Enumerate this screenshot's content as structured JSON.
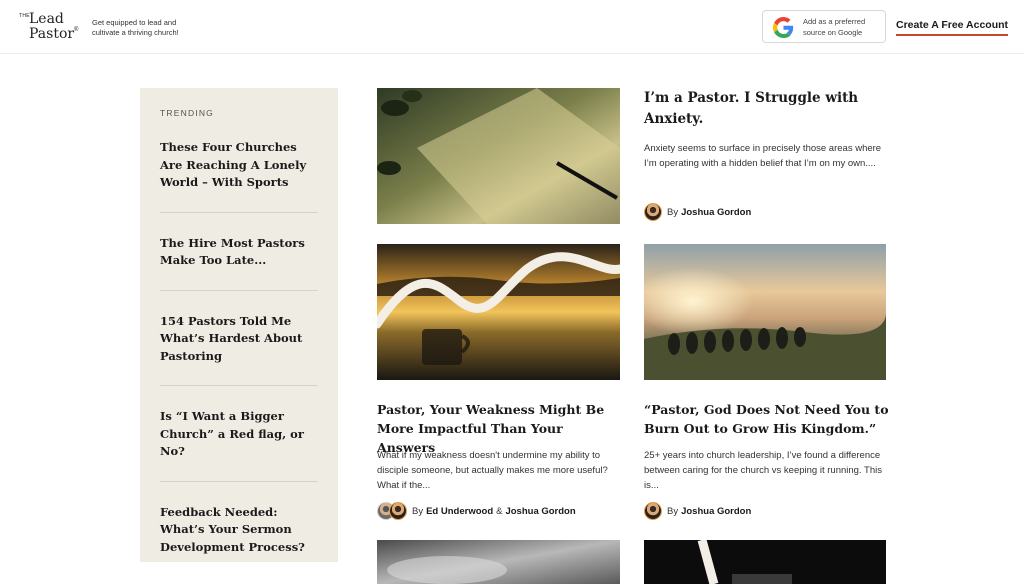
{
  "header": {
    "logo": {
      "the": "THE",
      "line1": "Lead",
      "line2": "Pastor",
      "reg": "®"
    },
    "tagline": "Get equipped to lead and cultivate a thriving church!",
    "google_badge": {
      "text": "Add as a preferred source on Google",
      "icon": "google-g-icon"
    },
    "cta": "Create A Free Account"
  },
  "colors": {
    "accent": "#c84a2e",
    "sidebar_bg": "#efece4"
  },
  "trending": {
    "label": "TRENDING",
    "items": [
      "These Four Churches Are Reaching A Lonely World – With Sports",
      "The Hire Most Pastors Make Too Late...",
      "154 Pastors Told Me What’s Hardest About Pastoring",
      "Is “I Want a Bigger Church” a Red flag, or No?",
      "Feedback Needed: What’s Your Sermon Development Process?"
    ]
  },
  "articles": [
    {
      "title": "I’m a Pastor. I Struggle with Anxiety.",
      "excerpt": "Anxiety seems to surface in precisely those areas where I’m operating with a hidden belief that I’m on my own....",
      "by": "By",
      "authors": [
        "Joshua Gordon"
      ]
    },
    {
      "title": "Pastor, Your Weakness Might Be More Impactful Than Your Answers",
      "excerpt": "What if my weakness doesn't undermine my ability to disciple someone, but actually makes me more useful? What if the...",
      "by": "By",
      "authors": [
        "Ed Underwood",
        "Joshua Gordon"
      ],
      "amp": "&"
    },
    {
      "title": "“Pastor, God Does Not Need You to Burn Out to Grow His Kingdom.”",
      "excerpt": "25+ years into church leadership, I’ve found a difference between caring for the church vs keeping it running. This is...",
      "by": "By",
      "authors": [
        "Joshua Gordon"
      ]
    }
  ]
}
